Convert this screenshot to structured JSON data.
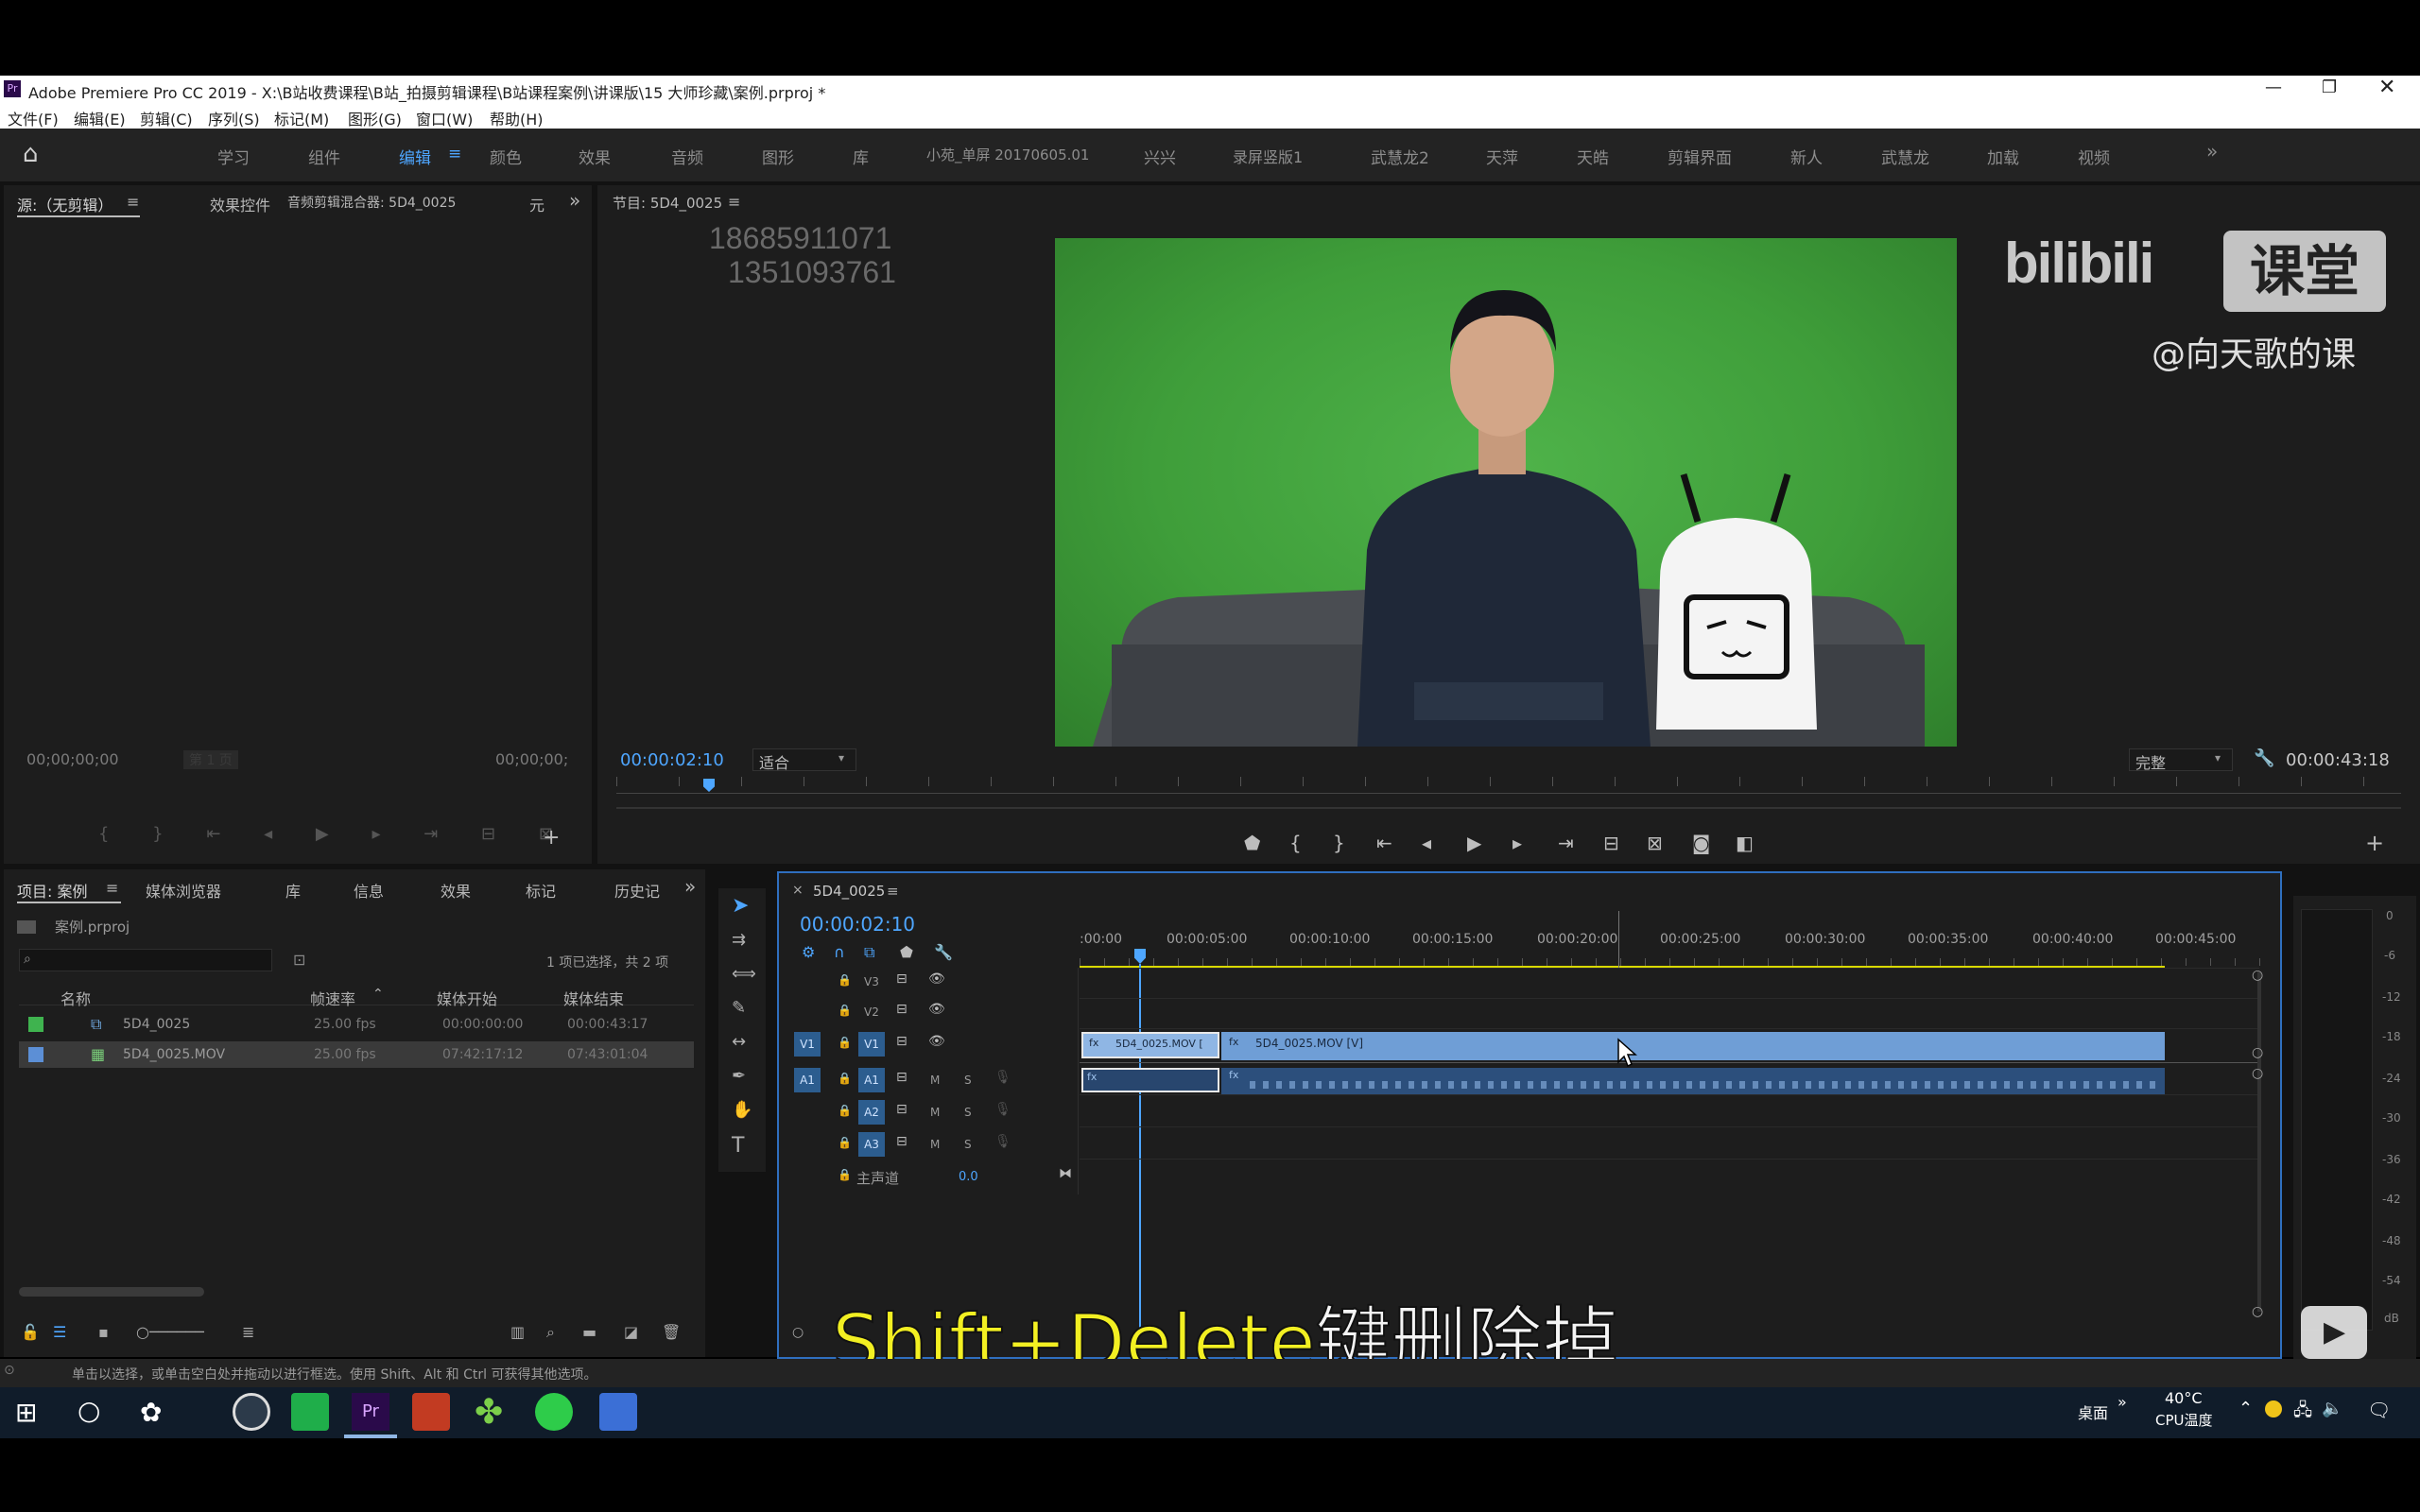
{
  "window": {
    "title": "Adobe Premiere Pro CC 2019 - X:\\B站收费课程\\B站_拍摄剪辑课程\\B站课程案例\\讲课版\\15 大师珍藏\\案例.prproj *",
    "app_badge": "Pr"
  },
  "menu": [
    "文件(F)",
    "编辑(E)",
    "剪辑(C)",
    "序列(S)",
    "标记(M)",
    "图形(G)",
    "窗口(W)",
    "帮助(H)"
  ],
  "workspaces": [
    "学习",
    "组件",
    "编辑",
    "颜色",
    "效果",
    "音频",
    "图形",
    "库",
    "小苑_单屏 20170605.01",
    "兴兴",
    "录屏竖版1",
    "武慧龙2",
    "天萍",
    "天皓",
    "剪辑界面",
    "新人",
    "武慧龙",
    "加载",
    "视频"
  ],
  "active_workspace": "编辑",
  "watermark": {
    "brand": "bilibili",
    "label": "课堂",
    "author": "@向天歌的课"
  },
  "phone_overlay": [
    "18685911071",
    "1351093761"
  ],
  "source_panel": {
    "tabs": [
      "源:（无剪辑）",
      "效果控件",
      "音频剪辑混合器: 5D4_0025",
      "元"
    ],
    "timecode_left": "00;00;00;00",
    "page": "第 1 页",
    "timecode_right": "00;00;00;"
  },
  "program_panel": {
    "title": "节目: 5D4_0025",
    "timecode": "00:00:02:10",
    "fit": "适合",
    "quality": "完整",
    "duration": "00:00:43:18"
  },
  "project_panel": {
    "tabs": [
      "项目: 案例",
      "媒体浏览器",
      "库",
      "信息",
      "效果",
      "标记",
      "历史记"
    ],
    "project_file": "案例.prproj",
    "selection_info": "1 项已选择，共 2 项",
    "columns": [
      "名称",
      "帧速率",
      "媒体开始",
      "媒体结束"
    ],
    "rows": [
      {
        "color": "#3fb34f",
        "name": "5D4_0025",
        "fps": "25.00 fps",
        "start": "00:00:00:00",
        "end": "00:00:43:17"
      },
      {
        "color": "#5c8fd6",
        "name": "5D4_0025.MOV",
        "fps": "25.00 fps",
        "start": "07:42:17:12",
        "end": "07:43:01:04"
      }
    ]
  },
  "timeline": {
    "sequence": "5D4_0025",
    "timecode": "00:00:02:10",
    "ruler": [
      ":00:00",
      "00:00:05:00",
      "00:00:10:00",
      "00:00:15:00",
      "00:00:20:00",
      "00:00:25:00",
      "00:00:30:00",
      "00:00:35:00",
      "00:00:40:00",
      "00:00:45:00"
    ],
    "video_tracks": [
      "V3",
      "V2",
      "V1"
    ],
    "audio_tracks": [
      "A1",
      "A2",
      "A3"
    ],
    "source_patch_v": "V1",
    "source_patch_a": "A1",
    "mute": "M",
    "solo": "S",
    "master_label": "主声道",
    "master_value": "0.0",
    "clips": {
      "v1_a": "5D4_0025.MOV [",
      "v1_b": "5D4_0025.MOV [V]"
    }
  },
  "meter_scale": [
    "0",
    "-6",
    "-12",
    "-18",
    "-24",
    "-30",
    "-36",
    "-42",
    "-48",
    "-54",
    "dB"
  ],
  "subtitle": {
    "latin": "Shift+Delete",
    "cjk": "键删除掉"
  },
  "status_bar": "单击以选择，或单击空白处并拖动以进行框选。使用 Shift、Alt 和 Ctrl 可获得其他选项。",
  "taskbar": {
    "desktop": "桌面",
    "temp": "40°C",
    "temp_label": "CPU温度"
  },
  "colors": {
    "panel_bg": "#1d1d1d",
    "accent_blue": "#4ea6ff",
    "clip_blue": "#6f9ed6",
    "green_screen": "#3f9e3a",
    "subtitle_yellow": "#f2ef22"
  }
}
